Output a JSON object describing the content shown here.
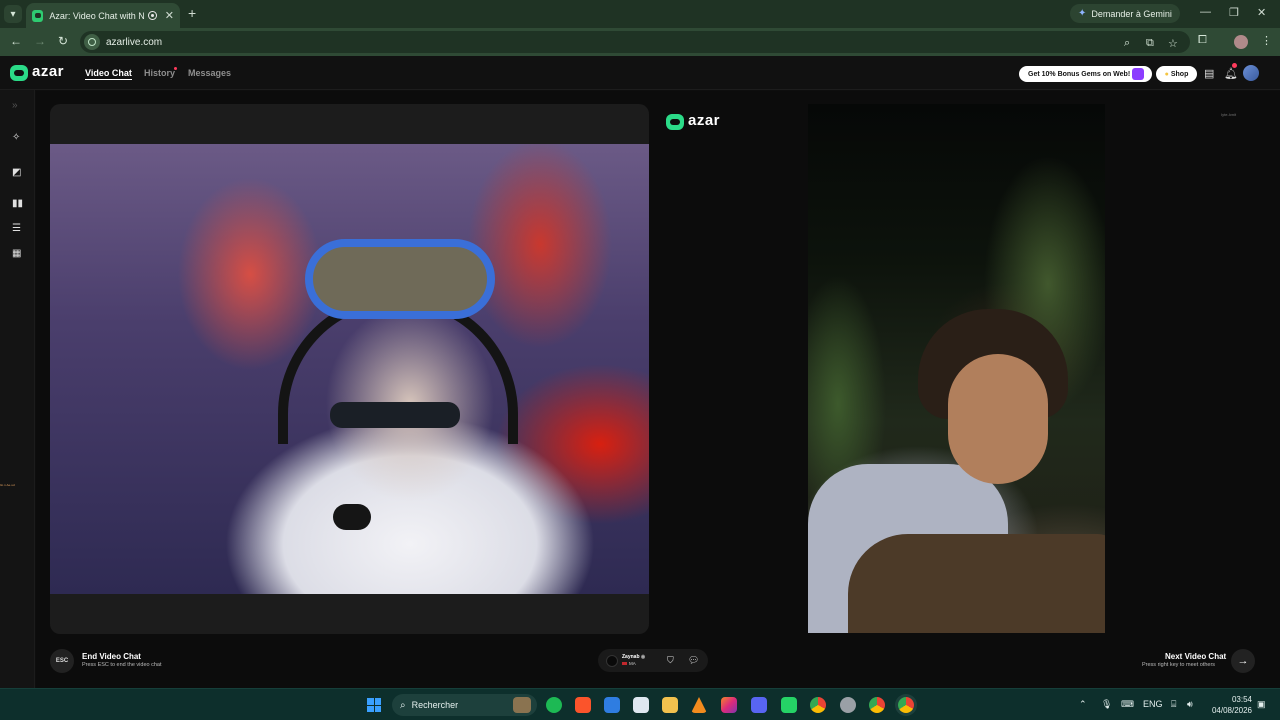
{
  "browser": {
    "tab_title": "Azar: Video Chat with New",
    "new_tab_icon": "+",
    "gemini_label": "Demander à Gemini",
    "url": "azarlive.com"
  },
  "app": {
    "logo_text": "azar",
    "nav": {
      "video_chat": "Video Chat",
      "history": "History",
      "messages": "Messages"
    },
    "gems_promo": "Get 10% Bonus Gems on Web!",
    "shop_label": "Shop"
  },
  "stage": {
    "center_logo": "azar",
    "watermark": "Iyte-Ivnit",
    "edge_text": "Gi·n·Ae·ud"
  },
  "controls": {
    "esc_key": "ESC",
    "end_title": "End Video Chat",
    "end_sub": "Press ESC to end the video chat",
    "partner_name": "Zaynab",
    "partner_country": "MA",
    "next_title": "Next Video Chat",
    "next_sub": "Press right key to meet others"
  },
  "taskbar": {
    "search_placeholder": "Rechercher",
    "lang": "ENG",
    "time": "03:54",
    "date": "04/08/2026"
  },
  "colors": {
    "accent_green": "#2bdb88",
    "chrome_green": "#2f4a35",
    "notification_red": "#ff3b5c"
  },
  "icons": [
    "search-icon",
    "share-icon",
    "star-icon",
    "extensions-icon",
    "profile-icon",
    "inbox-icon",
    "bell-icon",
    "shield-icon",
    "chat-icon",
    "arrow-right-icon",
    "effects-icon",
    "filter-icon",
    "layout-icon"
  ]
}
